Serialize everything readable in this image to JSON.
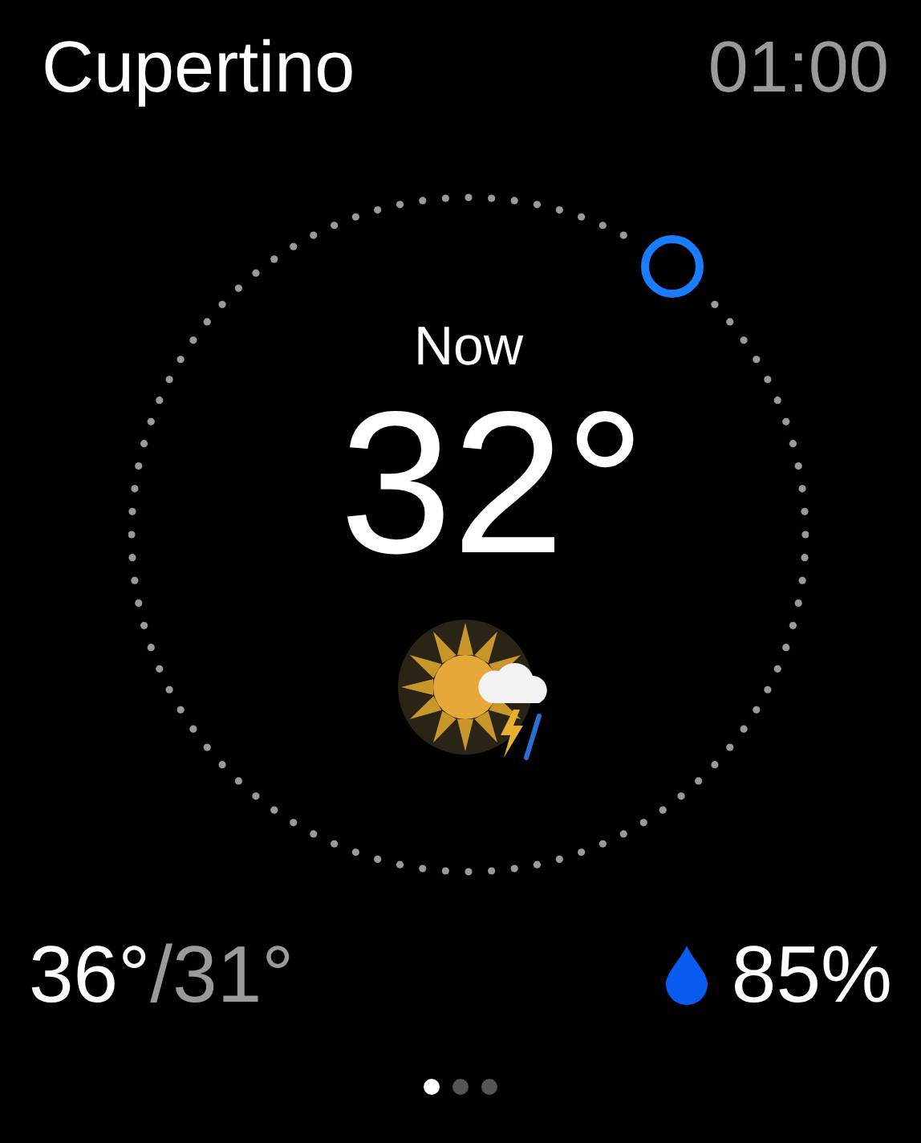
{
  "header": {
    "city": "Cupertino",
    "time": "01:00"
  },
  "current": {
    "label": "Now",
    "temperature": "32°"
  },
  "forecast": {
    "high": "36°",
    "low": "/31°",
    "humidity": "85%"
  },
  "pages": [
    {
      "selected": true
    },
    {
      "selected": false
    },
    {
      "selected": false
    }
  ]
}
